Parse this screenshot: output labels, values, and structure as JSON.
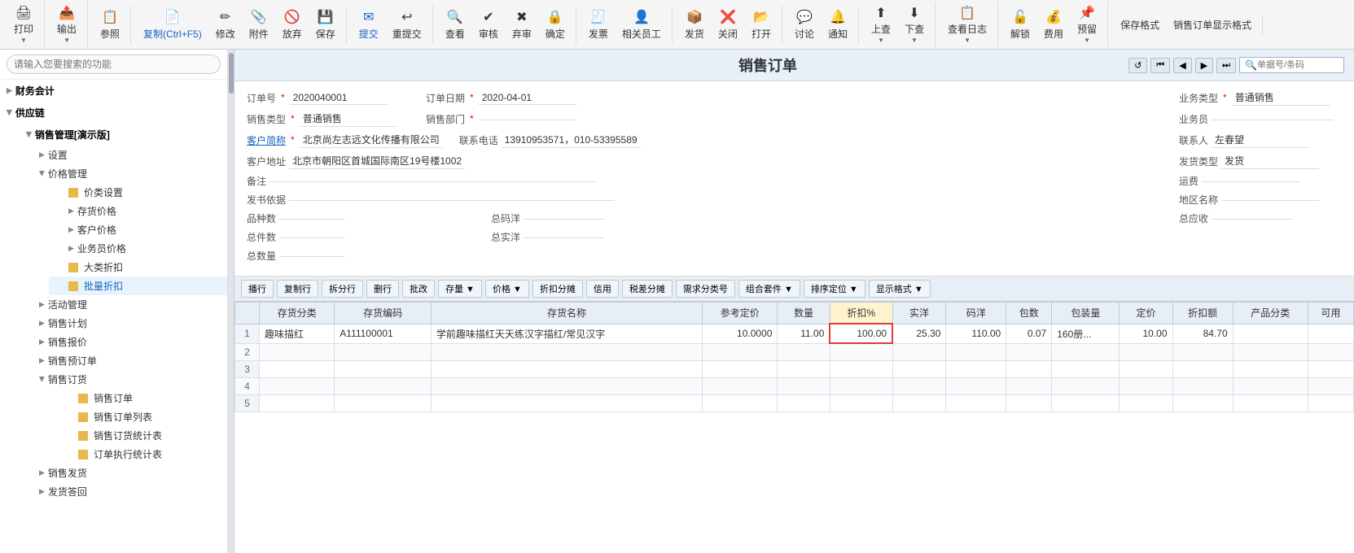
{
  "toolbar": {
    "buttons": [
      {
        "id": "print",
        "label": "打印",
        "icon": "🖨",
        "hasArrow": true
      },
      {
        "id": "output",
        "label": "输出",
        "icon": "📤",
        "hasArrow": true
      },
      {
        "id": "refer",
        "label": "参照",
        "icon": "📋"
      },
      {
        "id": "copy",
        "label": "复制(Ctrl+F5)",
        "icon": "📄"
      },
      {
        "id": "modify",
        "label": "修改",
        "icon": "✏"
      },
      {
        "id": "attach",
        "label": "附件",
        "icon": "📎"
      },
      {
        "id": "abandon",
        "label": "放弃",
        "icon": "🚫"
      },
      {
        "id": "save",
        "label": "保存",
        "icon": "💾"
      },
      {
        "id": "submit",
        "label": "提交",
        "icon": "✉",
        "highlight": true
      },
      {
        "id": "resubmit",
        "label": "重提交",
        "icon": "↩"
      },
      {
        "id": "review",
        "label": "查看",
        "icon": "🔍"
      },
      {
        "id": "approve",
        "label": "审核",
        "icon": "✔"
      },
      {
        "id": "abandon2",
        "label": "弃审",
        "icon": "✖"
      },
      {
        "id": "confirm",
        "label": "确定",
        "icon": "✓"
      },
      {
        "id": "invoice",
        "label": "发票",
        "icon": "🧾"
      },
      {
        "id": "related",
        "label": "相关员工",
        "icon": "👤"
      },
      {
        "id": "deliver",
        "label": "发货",
        "icon": "📦"
      },
      {
        "id": "close",
        "label": "关闭",
        "icon": "❌"
      },
      {
        "id": "open",
        "label": "打开",
        "icon": "📂"
      },
      {
        "id": "discuss",
        "label": "讨论",
        "icon": "💬"
      },
      {
        "id": "notify",
        "label": "通知",
        "icon": "🔔"
      },
      {
        "id": "prev",
        "label": "上查",
        "icon": "⬆",
        "hasArrow": true
      },
      {
        "id": "next",
        "label": "下查",
        "icon": "⬇",
        "hasArrow": true
      },
      {
        "id": "viewlog",
        "label": "查看日志",
        "icon": "📋",
        "hasArrow": true
      },
      {
        "id": "unlock",
        "label": "解锁",
        "icon": "🔓"
      },
      {
        "id": "fee",
        "label": "费用",
        "icon": "💰"
      },
      {
        "id": "prereserve",
        "label": "预留",
        "icon": "📌",
        "hasArrow": true
      },
      {
        "id": "savefmt",
        "label": "保存格式",
        "icon": "💾"
      },
      {
        "id": "viewsingle",
        "label": "销售订单显示格式",
        "icon": "📋"
      }
    ]
  },
  "sidebar": {
    "search_placeholder": "请输入您要搜索的功能",
    "items": [
      {
        "id": "finance",
        "label": "财务会计",
        "level": 1,
        "expanded": false,
        "icon": "▶"
      },
      {
        "id": "supply",
        "label": "供应链",
        "level": 1,
        "expanded": true,
        "icon": "▼"
      },
      {
        "id": "sales-mgmt",
        "label": "销售管理[演示版]",
        "level": 2,
        "expanded": true,
        "icon": "▼",
        "parent": "supply"
      },
      {
        "id": "settings",
        "label": "设置",
        "level": 3,
        "expanded": false,
        "icon": "▶",
        "parent": "sales-mgmt"
      },
      {
        "id": "price-mgmt",
        "label": "价格管理",
        "level": 3,
        "expanded": true,
        "icon": "▼",
        "parent": "sales-mgmt"
      },
      {
        "id": "price-settings",
        "label": "价类设置",
        "level": 4,
        "type": "doc",
        "parent": "price-mgmt"
      },
      {
        "id": "stock-price",
        "label": "存货价格",
        "level": 4,
        "expanded": false,
        "icon": "▶",
        "parent": "price-mgmt"
      },
      {
        "id": "customer-price",
        "label": "客户价格",
        "level": 4,
        "expanded": false,
        "icon": "▶",
        "parent": "price-mgmt"
      },
      {
        "id": "salesman-price",
        "label": "业务员价格",
        "level": 4,
        "expanded": false,
        "icon": "▶",
        "parent": "price-mgmt"
      },
      {
        "id": "bulk-discount",
        "label": "大类折扣",
        "level": 4,
        "type": "doc",
        "parent": "price-mgmt"
      },
      {
        "id": "batch-discount",
        "label": "批量折扣",
        "level": 4,
        "type": "doc",
        "active": true,
        "parent": "price-mgmt"
      },
      {
        "id": "activity-mgmt",
        "label": "活动管理",
        "level": 3,
        "expanded": false,
        "icon": "▶",
        "parent": "sales-mgmt"
      },
      {
        "id": "sales-plan",
        "label": "销售计划",
        "level": 3,
        "expanded": false,
        "icon": "▶",
        "parent": "sales-mgmt"
      },
      {
        "id": "sales-quote",
        "label": "销售报价",
        "level": 3,
        "expanded": false,
        "icon": "▶",
        "parent": "sales-mgmt"
      },
      {
        "id": "sales-preorder",
        "label": "销售预订单",
        "level": 3,
        "expanded": false,
        "icon": "▶",
        "parent": "sales-mgmt"
      },
      {
        "id": "sales-order",
        "label": "销售订货",
        "level": 3,
        "expanded": true,
        "icon": "▼",
        "parent": "sales-mgmt"
      },
      {
        "id": "sales-order-doc",
        "label": "销售订单",
        "level": 4,
        "type": "doc",
        "parent": "sales-order"
      },
      {
        "id": "sales-order-list",
        "label": "销售订单列表",
        "level": 4,
        "type": "doc",
        "parent": "sales-order"
      },
      {
        "id": "sales-order-stats",
        "label": "销售订货统计表",
        "level": 4,
        "type": "doc",
        "parent": "sales-order"
      },
      {
        "id": "order-exec-stats",
        "label": "订单执行统计表",
        "level": 4,
        "type": "doc",
        "parent": "sales-order"
      },
      {
        "id": "sales-delivery",
        "label": "销售发货",
        "level": 3,
        "expanded": false,
        "icon": "▶",
        "parent": "sales-mgmt"
      },
      {
        "id": "delivery-return",
        "label": "发货答回",
        "level": 3,
        "expanded": false,
        "icon": "▶",
        "parent": "sales-mgmt"
      }
    ]
  },
  "form": {
    "title": "销售订单",
    "order_number_label": "订单号",
    "order_number": "2020040001",
    "order_date_label": "订单日期",
    "order_date": "2020-04-01",
    "business_type_label": "业务类型",
    "business_type": "普通销售",
    "sales_type_label": "销售类型",
    "sales_type": "普通销售",
    "sales_dept_label": "销售部门",
    "sales_dept": "",
    "salesman_label": "业务员",
    "salesman": "",
    "customer_label": "客户简称",
    "customer": "北京尚左志远文化传播有限公司",
    "contact_label": "联系电话",
    "contact": "13910953571，010-53395589",
    "contact_person_label": "联系人",
    "contact_person": "左春望",
    "customer_addr_label": "客户地址",
    "customer_addr": "北京市朝阳区首城国际南区19号楼1002",
    "delivery_type_label": "发货类型",
    "delivery_type": "发货",
    "note_label": "备注",
    "note": "",
    "freight_label": "运费",
    "freight": "",
    "basis_label": "发书依据",
    "basis": "",
    "region_label": "地区名称",
    "region": "",
    "variety_label": "品种数",
    "variety": "",
    "total_price_label": "总码洋",
    "total_price": "",
    "total_receivable_label": "总应收",
    "total_receivable": "",
    "total_pieces_label": "总件数",
    "total_pieces": "",
    "total_actual_label": "总实洋",
    "total_actual": "",
    "total_quantity_label": "总数量",
    "total_quantity": ""
  },
  "table": {
    "toolbar_buttons": [
      "播行",
      "复制行",
      "拆分行",
      "删行",
      "批改",
      "存量▼",
      "价格▼",
      "折扣分摊",
      "信用",
      "税差分摊",
      "需求分类号",
      "组合套件▼",
      "排序定位▼",
      "显示格式▼"
    ],
    "columns": [
      "存货分类",
      "存货编码",
      "存货名称",
      "参考定价",
      "数量",
      "折扣%",
      "实洋",
      "码洋",
      "包数",
      "包装量",
      "定价",
      "折扣额",
      "产品分类",
      "可用"
    ],
    "rows": [
      {
        "num": 1,
        "category": "趣味描红",
        "code": "A111100001",
        "name": "学前趣味描红天天练汉字描红/常见汉字",
        "ref_price": "10.0000",
        "quantity": "11.00",
        "discount": "100.00",
        "actual": "25.30",
        "code_price": "110.00",
        "packs": "0.07",
        "pack_size": "160册...",
        "list_price": "10.00",
        "discount_amt": "84.70",
        "product_cat": "",
        "available": ""
      },
      {
        "num": 2,
        "category": "",
        "code": "",
        "name": "",
        "ref_price": "",
        "quantity": "",
        "discount": "",
        "actual": "",
        "code_price": "",
        "packs": "",
        "pack_size": "",
        "list_price": "",
        "discount_amt": "",
        "product_cat": "",
        "available": ""
      },
      {
        "num": 3,
        "category": "",
        "code": "",
        "name": "",
        "ref_price": "",
        "quantity": "",
        "discount": "",
        "actual": "",
        "code_price": "",
        "packs": "",
        "pack_size": "",
        "list_price": "",
        "discount_amt": "",
        "product_cat": "",
        "available": ""
      },
      {
        "num": 4,
        "category": "",
        "code": "",
        "name": "",
        "ref_price": "",
        "quantity": "",
        "discount": "",
        "actual": "",
        "code_price": "",
        "packs": "",
        "pack_size": "",
        "list_price": "",
        "discount_amt": "",
        "product_cat": "",
        "available": ""
      },
      {
        "num": 5,
        "category": "",
        "code": "",
        "name": "",
        "ref_price": "",
        "quantity": "",
        "discount": "",
        "actual": "",
        "code_price": "",
        "packs": "",
        "pack_size": "",
        "list_price": "",
        "discount_amt": "",
        "product_cat": "",
        "available": ""
      }
    ]
  },
  "nav": {
    "refresh_icon": "↺",
    "first_icon": "⏮",
    "prev_icon": "◀",
    "next_icon": "▶",
    "last_icon": "⏭",
    "search_placeholder": "单据号/条码"
  },
  "colors": {
    "header_bg": "#e8eef5",
    "accent": "#1565c0",
    "highlight_border": "#e53935",
    "sidebar_active": "#1565c0",
    "toolbar_bg": "#f5f5f5"
  }
}
